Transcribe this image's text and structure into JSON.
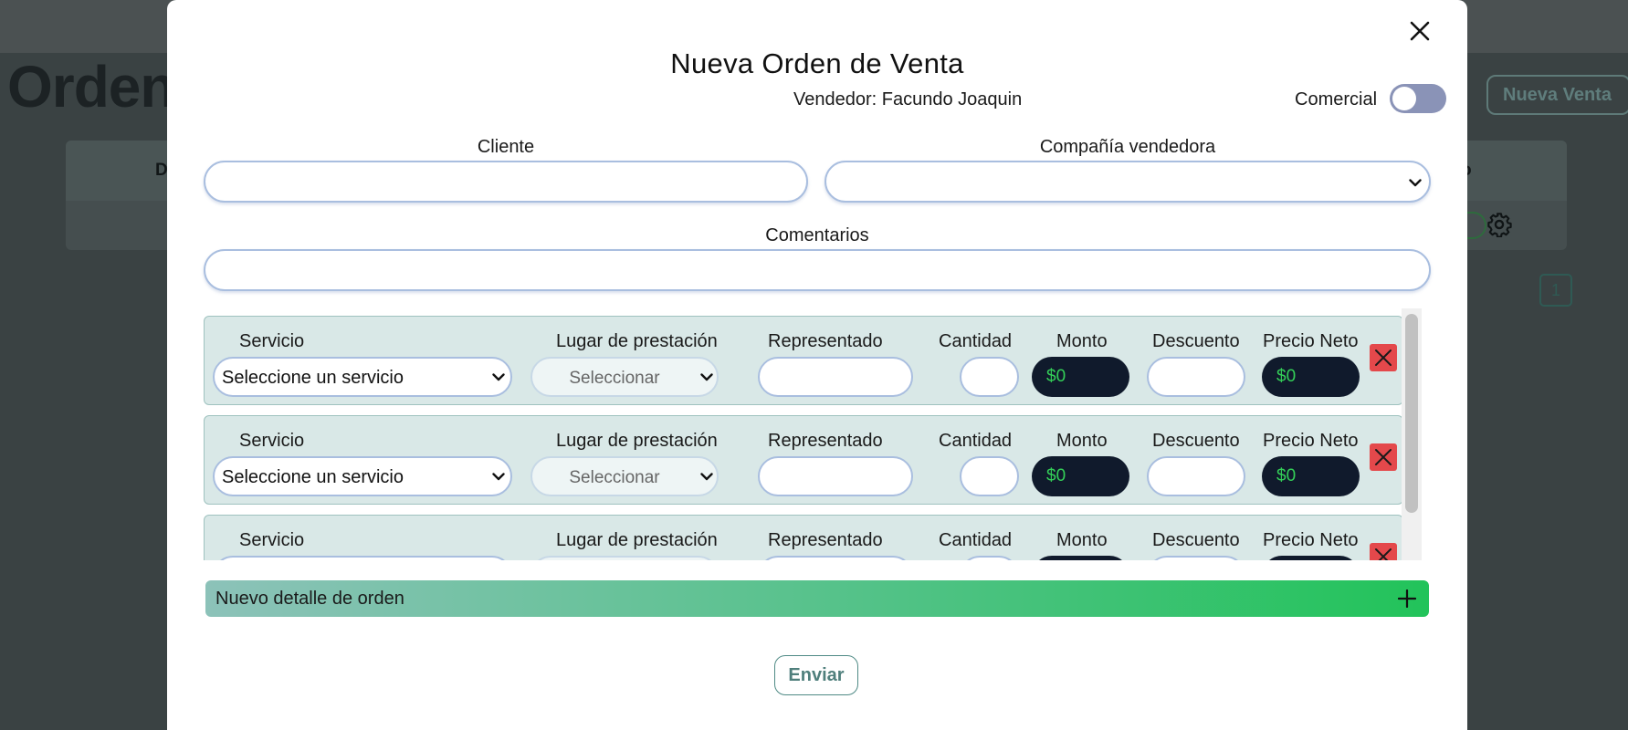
{
  "background": {
    "page_title": "Ordene",
    "new_sale_button": "Nueva Venta",
    "table_header_left": "D",
    "table_header_right": "o",
    "pagination_current": "1"
  },
  "modal": {
    "title": "Nueva Orden de Venta",
    "seller": "Vendedor: Facundo Joaquin",
    "comercial_label": "Comercial",
    "comercial_enabled": false,
    "client_label": "Cliente",
    "client_value": "",
    "company_label": "Compañía vendedora",
    "company_value": "",
    "comments_label": "Comentarios",
    "comments_value": "",
    "details": [
      {
        "servicio_label": "Servicio",
        "servicio_value": "Seleccione un servicio",
        "lugar_label": "Lugar de prestación",
        "lugar_value": "Seleccionar",
        "representado_label": "Representado",
        "representado_value": "",
        "cantidad_label": "Cantidad",
        "cantidad_value": "",
        "monto_label": "Monto",
        "monto_value": "$0",
        "descuento_label": "Descuento",
        "descuento_value": "",
        "precio_neto_label": "Precio Neto",
        "precio_neto_value": "$0"
      },
      {
        "servicio_label": "Servicio",
        "servicio_value": "Seleccione un servicio",
        "lugar_label": "Lugar de prestación",
        "lugar_value": "Seleccionar",
        "representado_label": "Representado",
        "representado_value": "",
        "cantidad_label": "Cantidad",
        "cantidad_value": "",
        "monto_label": "Monto",
        "monto_value": "$0",
        "descuento_label": "Descuento",
        "descuento_value": "",
        "precio_neto_label": "Precio Neto",
        "precio_neto_value": "$0"
      },
      {
        "servicio_label": "Servicio",
        "servicio_value": "",
        "lugar_label": "Lugar de prestación",
        "lugar_value": "",
        "representado_label": "Representado",
        "representado_value": "",
        "cantidad_label": "Cantidad",
        "cantidad_value": "",
        "monto_label": "Monto",
        "monto_value": "",
        "descuento_label": "Descuento",
        "descuento_value": "",
        "precio_neto_label": "Precio Neto",
        "precio_neto_value": ""
      }
    ],
    "add_detail_label": "Nuevo detalle de orden",
    "submit_label": "Enviar"
  },
  "colors": {
    "row_background": "#d9e8e7",
    "money_background": "#101a2c",
    "money_text": "#34d058",
    "delete_red": "#e4484b",
    "toggle_off": "#8a93b7",
    "accent_green": "#22c35a"
  },
  "icons": [
    "close-icon",
    "chevron-down-icon",
    "delete-x-icon",
    "plus-icon",
    "gear-icon"
  ]
}
